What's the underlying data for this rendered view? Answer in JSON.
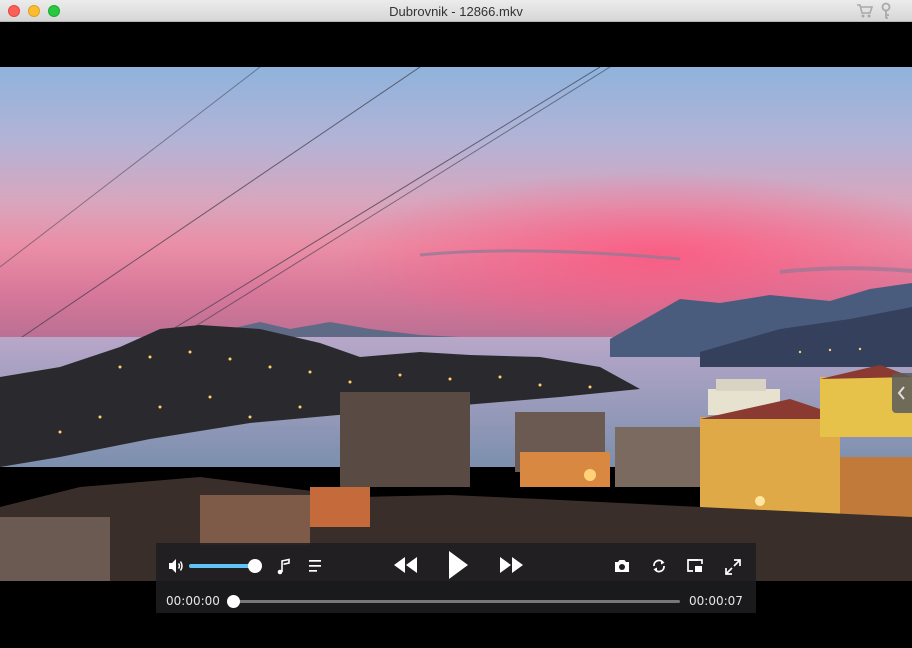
{
  "window": {
    "title": "Dubrovnik - 12866.mkv"
  },
  "titlebar_icons": [
    "cart-icon",
    "key-icon"
  ],
  "player": {
    "volume": 1.0,
    "progress": 0.0,
    "current_time": "00:00:00",
    "total_time": "00:00:07",
    "state": "paused"
  },
  "colors": {
    "accent": "#5fc3f5",
    "control_bg": "#1e1e20"
  },
  "icons": [
    "volume-icon",
    "music-note-icon",
    "playlist-icon",
    "rewind-icon",
    "play-icon",
    "fast-forward-icon",
    "camera-icon",
    "loop-icon",
    "picture-in-picture-icon",
    "fullscreen-icon",
    "sidebar-toggle-icon"
  ]
}
